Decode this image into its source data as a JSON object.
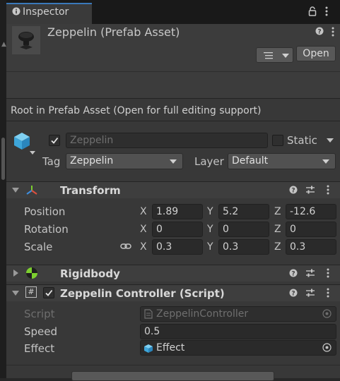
{
  "window": {
    "tab_label": "Inspector"
  },
  "header": {
    "title": "Zeppelin (Prefab Asset)",
    "open_button": "Open"
  },
  "notice": "Root in Prefab Asset (Open for full editing support)",
  "gameobject": {
    "active": true,
    "name": "Zeppelin",
    "static_label": "Static",
    "static": false,
    "tag_label": "Tag",
    "tag_value": "Zeppelin",
    "layer_label": "Layer",
    "layer_value": "Default"
  },
  "transform": {
    "title": "Transform",
    "expanded": true,
    "rows": [
      {
        "label": "Position",
        "x": "1.89",
        "y": "5.2",
        "z": "-12.6"
      },
      {
        "label": "Rotation",
        "x": "0",
        "y": "0",
        "z": "0"
      },
      {
        "label": "Scale",
        "x": "0.3",
        "y": "0.3",
        "z": "0.3"
      }
    ],
    "axis": {
      "x": "X",
      "y": "Y",
      "z": "Z"
    }
  },
  "rigidbody": {
    "title": "Rigidbody",
    "expanded": false
  },
  "controller": {
    "title": "Zeppelin Controller (Script)",
    "enabled": true,
    "expanded": true,
    "script_label": "Script",
    "script_value": "ZeppelinController",
    "speed_label": "Speed",
    "speed_value": "0.5",
    "effect_label": "Effect",
    "effect_value": "Effect"
  },
  "icons": {
    "tab": "inspector-info-icon",
    "lock": "lock-icon",
    "menu": "kebab-menu-icon",
    "help": "help-icon",
    "presets": "presets-sliders-icon",
    "link": "link-icon",
    "target": "object-picker-icon"
  },
  "colors": {
    "accent": "#3a79bb",
    "cube": "#4fb4e6",
    "rigidbody_icon": "#7ccf2f"
  }
}
